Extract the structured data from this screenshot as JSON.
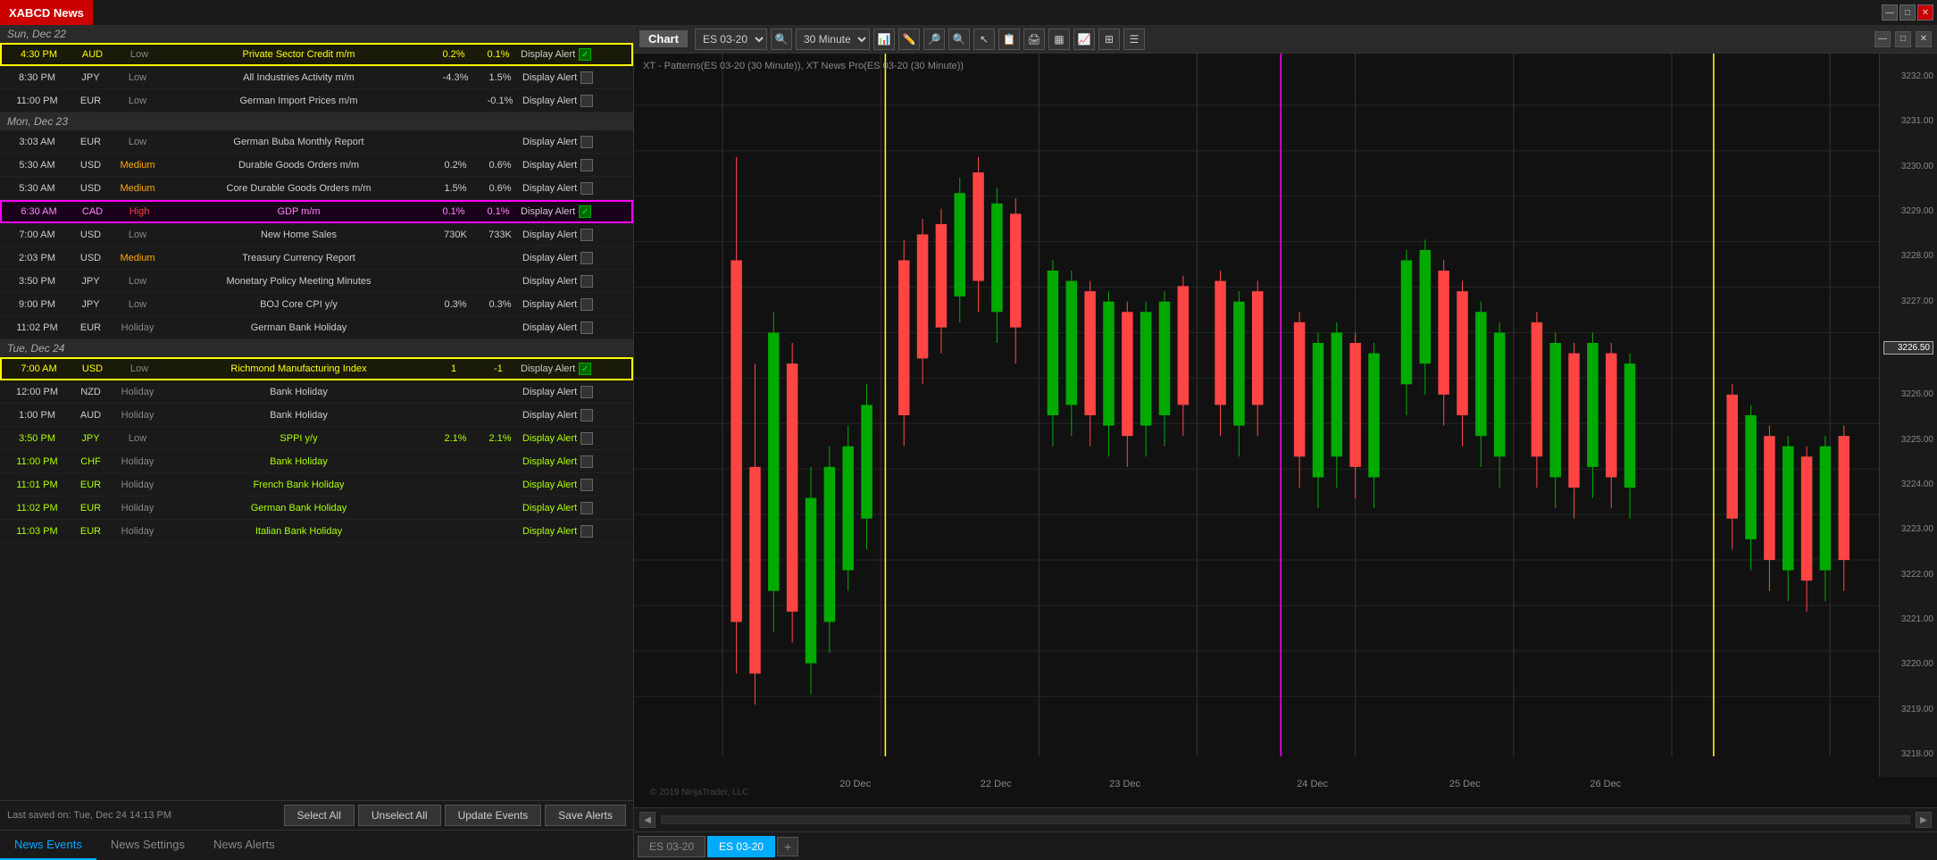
{
  "app": {
    "title": "XABCD News",
    "chart_title": "Chart"
  },
  "toolbar": {
    "instrument": "ES 03-20",
    "timeframe": "30 Minute",
    "price_current": "3226.50"
  },
  "chart": {
    "subtitle": "XT - Patterns(ES 03-20 (30 Minute)), XT News Pro(ES 03-20 (30 Minute))",
    "copyright": "© 2019 NinjaTrader, LLC",
    "prices": [
      "3232.00",
      "3231.00",
      "3230.00",
      "3229.00",
      "3228.00",
      "3227.00",
      "3226.50",
      "3226.00",
      "3225.00",
      "3224.00",
      "3223.00",
      "3222.00",
      "3221.00",
      "3220.00",
      "3219.00",
      "3218.00"
    ],
    "time_labels": [
      {
        "label": "20 Dec",
        "pos": 7
      },
      {
        "label": "22 Dec",
        "pos": 20
      },
      {
        "label": "23 Dec",
        "pos": 32
      },
      {
        "label": "24 Dec",
        "pos": 48
      },
      {
        "label": "25 Dec",
        "pos": 60
      },
      {
        "label": "26 Dec",
        "pos": 72
      }
    ]
  },
  "bottom_bar": {
    "last_saved": "Last saved on: Tue, Dec 24 14:13 PM",
    "select_all": "Select All",
    "unselect_all": "Unselect All",
    "update_events": "Update Events",
    "save_alerts": "Save Alerts"
  },
  "tabs": {
    "news_events": "News Events",
    "news_settings": "News Settings",
    "news_alerts": "News Alerts"
  },
  "chart_tabs": {
    "tab1": "ES 03-20",
    "tab2": "ES 03-20"
  },
  "dates": [
    {
      "date": "Sun, Dec 22",
      "rows": [
        {
          "time": "4:30 PM",
          "currency": "AUD",
          "impact": "Low",
          "name": "Private Sector Credit m/m",
          "actual": "0.2%",
          "forecast": "0.1%",
          "alert": true,
          "highlighted": "yellow"
        },
        {
          "time": "8:30 PM",
          "currency": "JPY",
          "impact": "Low",
          "name": "All Industries Activity m/m",
          "actual": "-4.3%",
          "forecast": "1.5%",
          "alert": false,
          "highlighted": "none"
        },
        {
          "time": "11:00 PM",
          "currency": "EUR",
          "impact": "Low",
          "name": "German Import Prices m/m",
          "actual": "",
          "forecast": "-0.1%",
          "alert": false,
          "highlighted": "none"
        }
      ]
    },
    {
      "date": "Mon, Dec 23",
      "rows": [
        {
          "time": "3:03 AM",
          "currency": "EUR",
          "impact": "Low",
          "name": "German Buba Monthly Report",
          "actual": "",
          "forecast": "",
          "alert": false,
          "highlighted": "none"
        },
        {
          "time": "5:30 AM",
          "currency": "USD",
          "impact": "Medium",
          "name": "Durable Goods Orders m/m",
          "actual": "0.2%",
          "forecast": "0.6%",
          "alert": false,
          "highlighted": "none"
        },
        {
          "time": "5:30 AM",
          "currency": "USD",
          "impact": "Medium",
          "name": "Core Durable Goods Orders m/m",
          "actual": "1.5%",
          "forecast": "0.6%",
          "alert": false,
          "highlighted": "none"
        },
        {
          "time": "6:30 AM",
          "currency": "CAD",
          "impact": "High",
          "name": "GDP m/m",
          "actual": "0.1%",
          "forecast": "0.1%",
          "alert": true,
          "highlighted": "magenta"
        },
        {
          "time": "7:00 AM",
          "currency": "USD",
          "impact": "Low",
          "name": "New Home Sales",
          "actual": "730K",
          "forecast": "733K",
          "alert": false,
          "highlighted": "none"
        },
        {
          "time": "2:03 PM",
          "currency": "USD",
          "impact": "Medium",
          "name": "Treasury Currency Report",
          "actual": "",
          "forecast": "",
          "alert": false,
          "highlighted": "none"
        },
        {
          "time": "3:50 PM",
          "currency": "JPY",
          "impact": "Low",
          "name": "Monetary Policy Meeting Minutes",
          "actual": "",
          "forecast": "",
          "alert": false,
          "highlighted": "none"
        },
        {
          "time": "9:00 PM",
          "currency": "JPY",
          "impact": "Low",
          "name": "BOJ Core CPI y/y",
          "actual": "0.3%",
          "forecast": "0.3%",
          "alert": false,
          "highlighted": "none"
        },
        {
          "time": "11:02 PM",
          "currency": "EUR",
          "impact": "Holiday",
          "name": "German Bank Holiday",
          "actual": "",
          "forecast": "",
          "alert": false,
          "highlighted": "none"
        }
      ]
    },
    {
      "date": "Tue, Dec 24",
      "rows": [
        {
          "time": "7:00 AM",
          "currency": "USD",
          "impact": "Low",
          "name": "Richmond Manufacturing Index",
          "actual": "1",
          "forecast": "-1",
          "alert": true,
          "highlighted": "yellow"
        },
        {
          "time": "12:00 PM",
          "currency": "NZD",
          "impact": "Holiday",
          "name": "Bank Holiday",
          "actual": "",
          "forecast": "",
          "alert": false,
          "highlighted": "none"
        },
        {
          "time": "1:00 PM",
          "currency": "AUD",
          "impact": "Holiday",
          "name": "Bank Holiday",
          "actual": "",
          "forecast": "",
          "alert": false,
          "highlighted": "none"
        },
        {
          "time": "3:50 PM",
          "currency": "JPY",
          "impact": "Low",
          "name": "SPPI y/y",
          "actual": "2.1%",
          "forecast": "2.1%",
          "alert": false,
          "highlighted": "bright"
        },
        {
          "time": "11:00 PM",
          "currency": "CHF",
          "impact": "Holiday",
          "name": "Bank Holiday",
          "actual": "",
          "forecast": "",
          "alert": false,
          "highlighted": "bright"
        },
        {
          "time": "11:01 PM",
          "currency": "EUR",
          "impact": "Holiday",
          "name": "French Bank Holiday",
          "actual": "",
          "forecast": "",
          "alert": false,
          "highlighted": "bright"
        },
        {
          "time": "11:02 PM",
          "currency": "EUR",
          "impact": "Holiday",
          "name": "German Bank Holiday",
          "actual": "",
          "forecast": "",
          "alert": false,
          "highlighted": "bright"
        },
        {
          "time": "11:03 PM",
          "currency": "EUR",
          "impact": "Holiday",
          "name": "Italian Bank Holiday",
          "actual": "",
          "forecast": "",
          "alert": false,
          "highlighted": "bright"
        }
      ]
    }
  ]
}
